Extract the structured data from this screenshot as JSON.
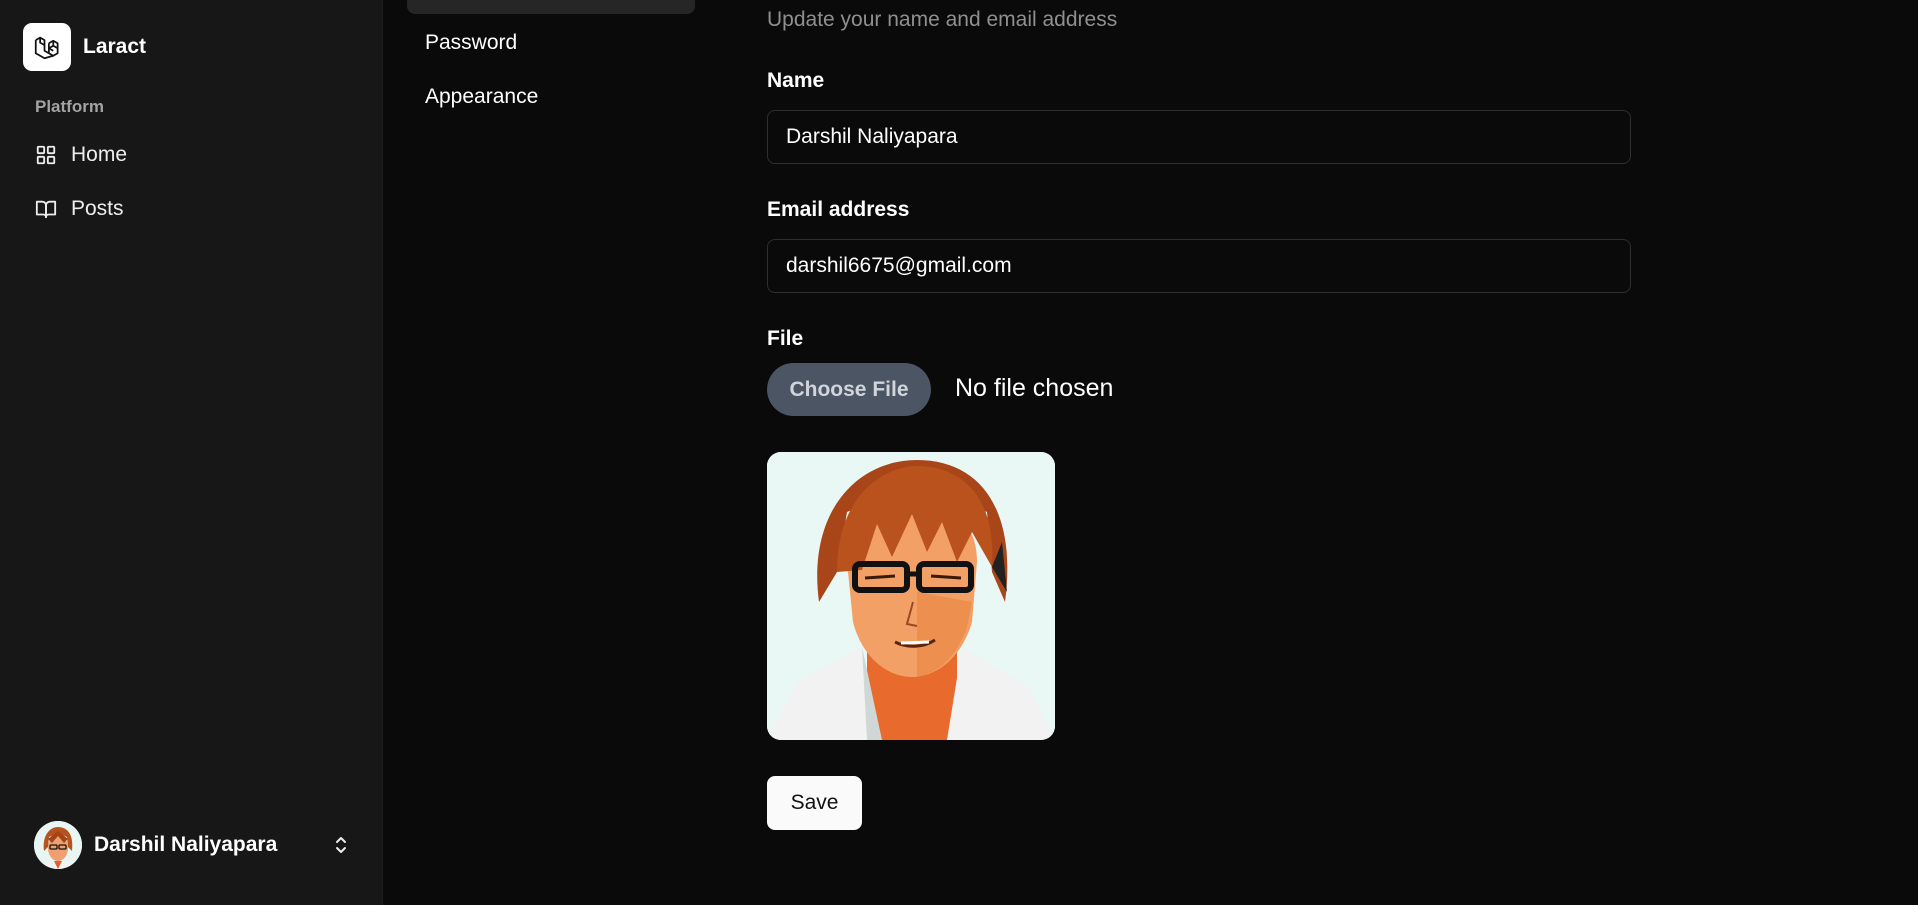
{
  "brand": {
    "name": "Laract",
    "logo_icon": "laravel-logo-icon"
  },
  "sidebar": {
    "group_label": "Platform",
    "items": [
      {
        "label": "Home",
        "icon": "grid-icon"
      },
      {
        "label": "Posts",
        "icon": "book-open-icon"
      }
    ],
    "user": {
      "name": "Darshil Naliyapara",
      "menu_icon": "chevrons-up-down-icon"
    }
  },
  "settings_nav": {
    "items": [
      {
        "label": "Password"
      },
      {
        "label": "Appearance"
      }
    ]
  },
  "profile_form": {
    "subtitle": "Update your name and email address",
    "name_label": "Name",
    "name_value": "Darshil Naliyapara",
    "email_label": "Email address",
    "email_value": "darshil6675@gmail.com",
    "file_label": "File",
    "file_button": "Choose File",
    "file_status": "No file chosen",
    "save_label": "Save"
  },
  "colors": {
    "background": "#0a0a0a",
    "sidebar": "#171717",
    "file_button": "#4b5563",
    "save_button": "#fafafa"
  }
}
